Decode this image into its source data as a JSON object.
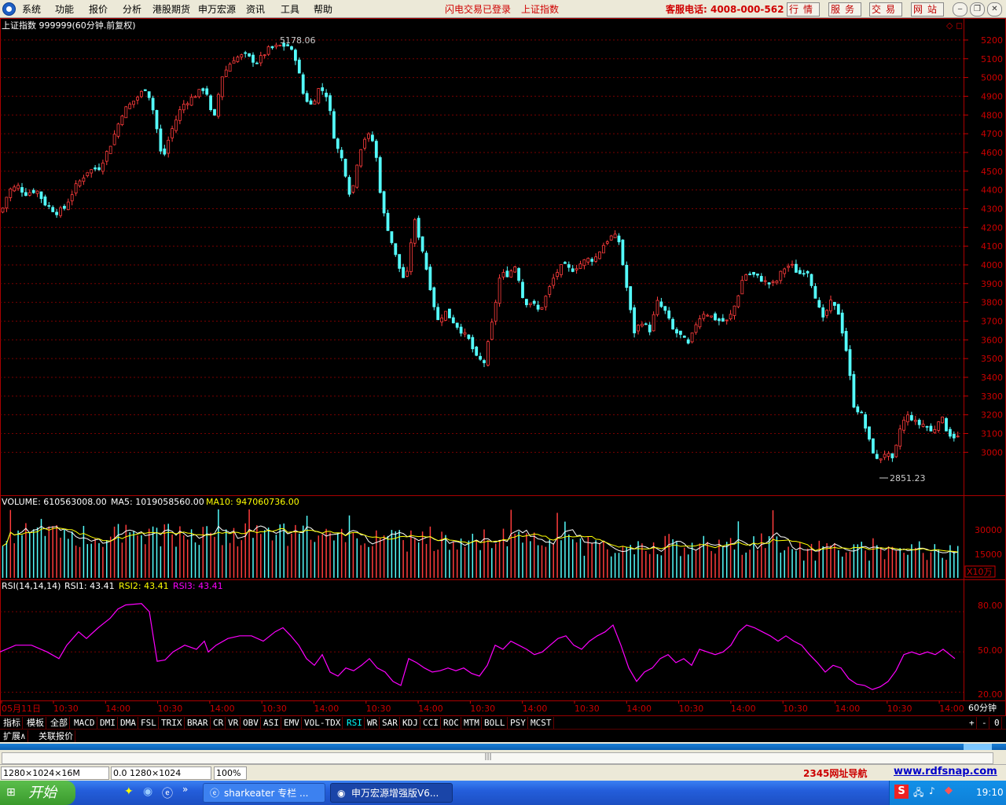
{
  "menu": {
    "items": [
      "系统",
      "功能",
      "报价",
      "分析",
      "港股期货",
      "申万宏源",
      "资讯",
      "工具",
      "帮助"
    ]
  },
  "header": {
    "flash_status": "闪电交易已登录",
    "index_name": "上证指数",
    "hotline": "客服电话: 4008-000-562",
    "buttons": [
      "行情",
      "服务",
      "交易",
      "网站"
    ]
  },
  "main_chart": {
    "title": "上证指数 999999(60分钟.前复权)",
    "high_label": "5178.06",
    "low_label": "2851.23",
    "y_ticks": [
      5200,
      5100,
      5000,
      4900,
      4800,
      4700,
      4600,
      4500,
      4400,
      4300,
      4200,
      4100,
      4000,
      3900,
      3800,
      3700,
      3600,
      3500,
      3400,
      3300,
      3200,
      3100,
      3000
    ]
  },
  "volume": {
    "label": "VOLUME: 610563008.00",
    "ma5": "MA5: 1019058560.00",
    "ma10": "MA10: 947060736.00",
    "y_ticks": [
      "30000",
      "15000"
    ],
    "unit": "X10万"
  },
  "rsi": {
    "label": "RSI(14,14,14)",
    "rsi1": "RSI1: 43.41",
    "rsi2": "RSI2: 43.41",
    "rsi3": "RSI3: 43.41",
    "y_ticks": [
      "80.00",
      "50.00",
      "20.00"
    ]
  },
  "x_axis": {
    "labels": [
      "05月11日",
      "10:30",
      "14:00",
      "10:30",
      "14:00",
      "10:30",
      "14:00",
      "10:30",
      "14:00",
      "10:30",
      "14:00",
      "10:30",
      "14:00",
      "10:30",
      "14:00",
      "10:30",
      "14:00",
      "10:30",
      "14:00"
    ],
    "period": "60分钟"
  },
  "tabs": [
    "指标",
    "模板",
    "全部",
    "MACD",
    "DMI",
    "DMA",
    "FSL",
    "TRIX",
    "BRAR",
    "CR",
    "VR",
    "OBV",
    "ASI",
    "EMV",
    "VOL-TDX",
    "RSI",
    "WR",
    "SAR",
    "KDJ",
    "CCI",
    "ROC",
    "MTM",
    "BOLL",
    "PSY",
    "MCST"
  ],
  "tabs2": [
    "扩展∧",
    "关联报价"
  ],
  "scroll_controls": [
    "+",
    "-",
    "0"
  ],
  "statusbar": {
    "s1": "1280×1024×16M",
    "s2": "0.0 1280×1024",
    "s3": "100%",
    "nav": "2345网址导航",
    "site": "www.rdfsnap.com"
  },
  "taskbar": {
    "start": "开始",
    "task1": "sharkeater 专栏 ...",
    "task2": "申万宏源增强版V6...",
    "clock": "19:10"
  },
  "chart_data": {
    "type": "candlestick",
    "close_path": [
      [
        0,
        4280
      ],
      [
        10,
        4400
      ],
      [
        22,
        4420
      ],
      [
        30,
        4380
      ],
      [
        45,
        4400
      ],
      [
        55,
        4330
      ],
      [
        70,
        4280
      ],
      [
        80,
        4300
      ],
      [
        95,
        4420
      ],
      [
        110,
        4500
      ],
      [
        125,
        4520
      ],
      [
        140,
        4650
      ],
      [
        155,
        4820
      ],
      [
        170,
        4880
      ],
      [
        185,
        4950
      ],
      [
        195,
        4800
      ],
      [
        205,
        4550
      ],
      [
        215,
        4700
      ],
      [
        230,
        4850
      ],
      [
        245,
        4900
      ],
      [
        260,
        4950
      ],
      [
        270,
        4750
      ],
      [
        280,
        5000
      ],
      [
        295,
        5100
      ],
      [
        310,
        5120
      ],
      [
        325,
        5080
      ],
      [
        340,
        5150
      ],
      [
        355,
        5170
      ],
      [
        365,
        5170
      ],
      [
        375,
        5100
      ],
      [
        385,
        4900
      ],
      [
        395,
        4850
      ],
      [
        405,
        4950
      ],
      [
        415,
        4900
      ],
      [
        425,
        4650
      ],
      [
        435,
        4550
      ],
      [
        445,
        4350
      ],
      [
        455,
        4600
      ],
      [
        465,
        4700
      ],
      [
        475,
        4650
      ],
      [
        485,
        4300
      ],
      [
        495,
        4150
      ],
      [
        505,
        4000
      ],
      [
        515,
        3900
      ],
      [
        525,
        4250
      ],
      [
        535,
        4100
      ],
      [
        545,
        3900
      ],
      [
        555,
        3700
      ],
      [
        565,
        3750
      ],
      [
        575,
        3700
      ],
      [
        585,
        3650
      ],
      [
        595,
        3600
      ],
      [
        605,
        3500
      ],
      [
        615,
        3480
      ],
      [
        625,
        3700
      ],
      [
        635,
        3950
      ],
      [
        645,
        3950
      ],
      [
        655,
        4000
      ],
      [
        665,
        3800
      ],
      [
        675,
        3800
      ],
      [
        685,
        3750
      ],
      [
        695,
        3850
      ],
      [
        705,
        3950
      ],
      [
        715,
        4000
      ],
      [
        725,
        3970
      ],
      [
        735,
        4000
      ],
      [
        745,
        4030
      ],
      [
        755,
        4030
      ],
      [
        765,
        4100
      ],
      [
        775,
        4150
      ],
      [
        785,
        4150
      ],
      [
        795,
        3900
      ],
      [
        805,
        3640
      ],
      [
        815,
        3700
      ],
      [
        825,
        3650
      ],
      [
        835,
        3800
      ],
      [
        845,
        3750
      ],
      [
        855,
        3650
      ],
      [
        865,
        3620
      ],
      [
        875,
        3570
      ],
      [
        885,
        3700
      ],
      [
        895,
        3750
      ],
      [
        905,
        3720
      ],
      [
        915,
        3700
      ],
      [
        925,
        3700
      ],
      [
        935,
        3800
      ],
      [
        945,
        3950
      ],
      [
        955,
        3950
      ],
      [
        965,
        3930
      ],
      [
        975,
        3900
      ],
      [
        985,
        3900
      ],
      [
        995,
        3980
      ],
      [
        1005,
        4000
      ],
      [
        1015,
        3950
      ],
      [
        1025,
        3980
      ],
      [
        1035,
        3850
      ],
      [
        1045,
        3700
      ],
      [
        1055,
        3800
      ],
      [
        1065,
        3750
      ],
      [
        1075,
        3550
      ],
      [
        1085,
        3250
      ],
      [
        1095,
        3200
      ],
      [
        1105,
        3050
      ],
      [
        1115,
        2950
      ],
      [
        1125,
        3000
      ],
      [
        1135,
        2950
      ],
      [
        1145,
        3150
      ],
      [
        1155,
        3200
      ],
      [
        1165,
        3150
      ],
      [
        1175,
        3150
      ],
      [
        1185,
        3100
      ],
      [
        1195,
        3200
      ],
      [
        1205,
        3100
      ],
      [
        1215,
        3080
      ]
    ],
    "ylim": [
      2800,
      5250
    ],
    "rsi_path": [
      [
        0,
        50
      ],
      [
        20,
        55
      ],
      [
        40,
        55
      ],
      [
        60,
        50
      ],
      [
        75,
        45
      ],
      [
        85,
        55
      ],
      [
        100,
        65
      ],
      [
        110,
        60
      ],
      [
        125,
        68
      ],
      [
        140,
        75
      ],
      [
        150,
        82
      ],
      [
        160,
        85
      ],
      [
        180,
        86
      ],
      [
        190,
        80
      ],
      [
        200,
        43
      ],
      [
        210,
        44
      ],
      [
        220,
        50
      ],
      [
        235,
        55
      ],
      [
        250,
        52
      ],
      [
        260,
        58
      ],
      [
        265,
        50
      ],
      [
        275,
        55
      ],
      [
        290,
        60
      ],
      [
        305,
        62
      ],
      [
        320,
        62
      ],
      [
        335,
        58
      ],
      [
        350,
        65
      ],
      [
        360,
        68
      ],
      [
        370,
        62
      ],
      [
        380,
        55
      ],
      [
        390,
        45
      ],
      [
        400,
        40
      ],
      [
        410,
        48
      ],
      [
        420,
        35
      ],
      [
        430,
        32
      ],
      [
        440,
        38
      ],
      [
        450,
        36
      ],
      [
        460,
        40
      ],
      [
        470,
        45
      ],
      [
        480,
        38
      ],
      [
        490,
        35
      ],
      [
        500,
        28
      ],
      [
        510,
        25
      ],
      [
        520,
        45
      ],
      [
        530,
        42
      ],
      [
        540,
        38
      ],
      [
        550,
        35
      ],
      [
        560,
        36
      ],
      [
        570,
        38
      ],
      [
        580,
        36
      ],
      [
        590,
        38
      ],
      [
        600,
        34
      ],
      [
        610,
        32
      ],
      [
        620,
        40
      ],
      [
        630,
        55
      ],
      [
        640,
        52
      ],
      [
        650,
        58
      ],
      [
        660,
        55
      ],
      [
        670,
        52
      ],
      [
        680,
        48
      ],
      [
        690,
        50
      ],
      [
        700,
        55
      ],
      [
        710,
        60
      ],
      [
        720,
        62
      ],
      [
        730,
        55
      ],
      [
        740,
        52
      ],
      [
        750,
        58
      ],
      [
        760,
        62
      ],
      [
        770,
        65
      ],
      [
        780,
        70
      ],
      [
        790,
        55
      ],
      [
        800,
        38
      ],
      [
        810,
        28
      ],
      [
        820,
        35
      ],
      [
        830,
        38
      ],
      [
        840,
        45
      ],
      [
        850,
        48
      ],
      [
        860,
        42
      ],
      [
        870,
        45
      ],
      [
        880,
        40
      ],
      [
        890,
        52
      ],
      [
        900,
        50
      ],
      [
        910,
        48
      ],
      [
        920,
        50
      ],
      [
        930,
        55
      ],
      [
        940,
        65
      ],
      [
        950,
        70
      ],
      [
        960,
        68
      ],
      [
        970,
        65
      ],
      [
        980,
        62
      ],
      [
        990,
        58
      ],
      [
        1000,
        62
      ],
      [
        1010,
        58
      ],
      [
        1020,
        55
      ],
      [
        1030,
        48
      ],
      [
        1040,
        42
      ],
      [
        1050,
        35
      ],
      [
        1060,
        40
      ],
      [
        1070,
        38
      ],
      [
        1080,
        30
      ],
      [
        1090,
        26
      ],
      [
        1100,
        25
      ],
      [
        1110,
        22
      ],
      [
        1120,
        24
      ],
      [
        1130,
        28
      ],
      [
        1140,
        36
      ],
      [
        1150,
        48
      ],
      [
        1160,
        50
      ],
      [
        1170,
        48
      ],
      [
        1180,
        50
      ],
      [
        1190,
        48
      ],
      [
        1200,
        52
      ],
      [
        1215,
        45
      ]
    ],
    "rsi_ylim": [
      15,
      90
    ]
  }
}
